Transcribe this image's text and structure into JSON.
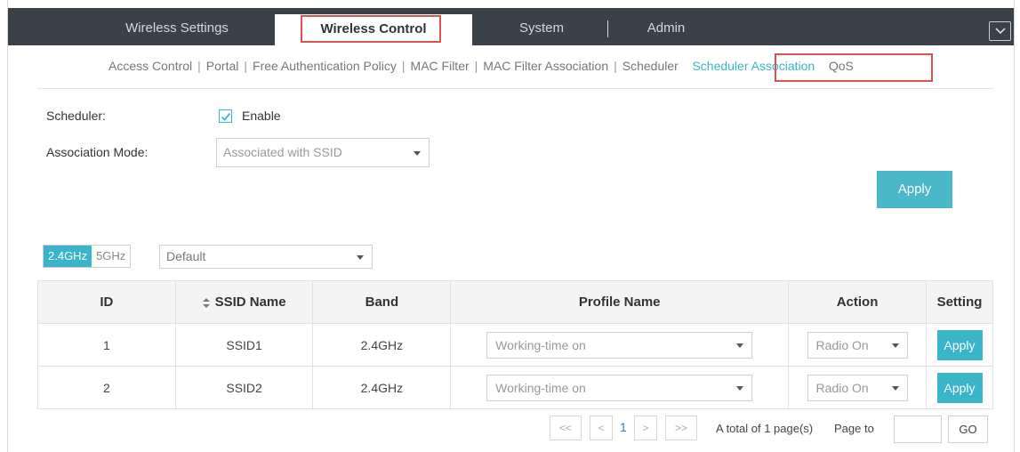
{
  "topnav": {
    "tabs": [
      "Wireless Settings",
      "Wireless Control",
      "System",
      "Admin"
    ],
    "active_tab": "Wireless Control"
  },
  "subnav": {
    "items": [
      "Access Control",
      "Portal",
      "Free Authentication Policy",
      "MAC Filter",
      "MAC Filter Association",
      "Scheduler",
      "Scheduler Association",
      "QoS"
    ],
    "active_item": "Scheduler Association"
  },
  "form": {
    "scheduler_label": "Scheduler:",
    "enable_label": "Enable",
    "enable_checked": true,
    "assoc_mode_label": "Association Mode:",
    "assoc_mode_value": "Associated with SSID",
    "apply_label": "Apply"
  },
  "filter": {
    "band_24": "2.4GHz",
    "band_5": "5GHz",
    "selected_band": "2.4GHz",
    "profile_value": "Default"
  },
  "table": {
    "columns": [
      "ID",
      "SSID Name",
      "Band",
      "Profile Name",
      "Action",
      "Setting"
    ],
    "rows": [
      {
        "id": "1",
        "ssid": "SSID1",
        "band": "2.4GHz",
        "profile": "Working-time on",
        "action": "Radio On",
        "setting": "Apply"
      },
      {
        "id": "2",
        "ssid": "SSID2",
        "band": "2.4GHz",
        "profile": "Working-time on",
        "action": "Radio On",
        "setting": "Apply"
      }
    ]
  },
  "pagination": {
    "first": "<<",
    "prev": "<",
    "current": "1",
    "next": ">",
    "last": ">>",
    "total_text": "A total of 1 page(s)",
    "page_to_label": "Page to",
    "go_label": "GO"
  },
  "colors": {
    "accent": "#3ab4c8",
    "topbar": "#3b4149",
    "highlight": "#d9534f"
  }
}
